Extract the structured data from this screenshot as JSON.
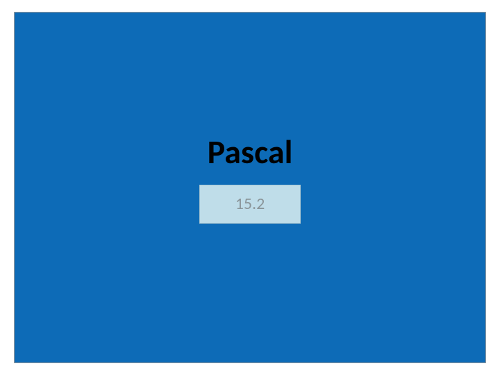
{
  "slide": {
    "title": "Pascal",
    "subtitle": "15.2"
  },
  "colors": {
    "background": "#0d6bb7",
    "subtitle_box": "#bfdde9",
    "title_text": "#000000",
    "subtitle_text": "#8a9599"
  }
}
